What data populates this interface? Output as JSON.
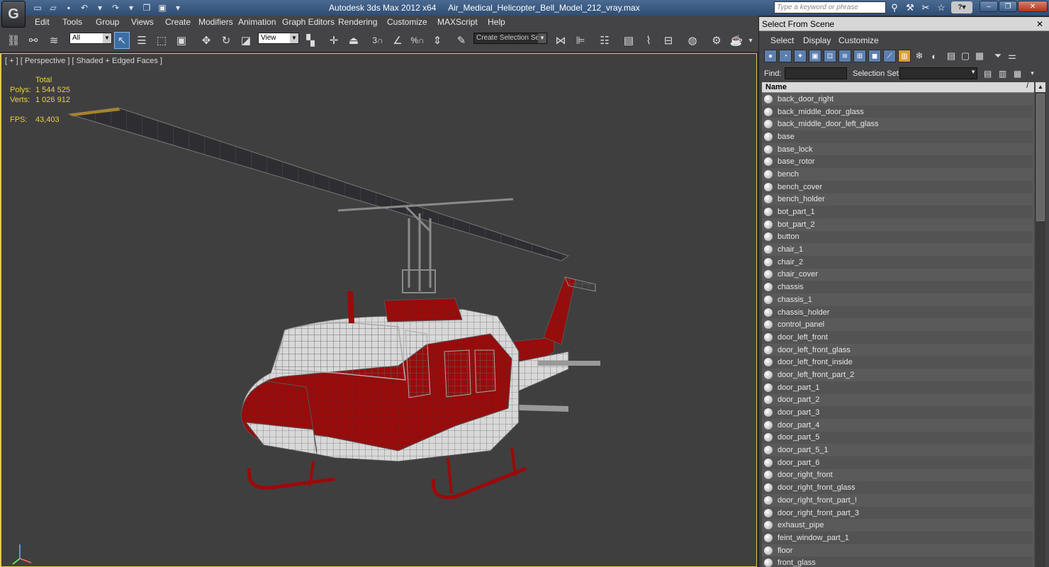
{
  "app": {
    "title": "Autodesk 3ds Max  2012 x64",
    "filename": "Air_Medical_Helicopter_Bell_Model_212_vray.max",
    "logo": "3ds-max-logo"
  },
  "search": {
    "placeholder": "Type a keyword or phrase"
  },
  "menus": [
    "Edit",
    "Tools",
    "Group",
    "Views",
    "Create",
    "Modifiers",
    "Animation",
    "Graph Editors",
    "Rendering",
    "Customize",
    "MAXScript",
    "Help"
  ],
  "toolbar": {
    "filter_value": "All",
    "ref_coord_value": "View",
    "selection_set_placeholder": "Create Selection Se"
  },
  "viewport": {
    "label": "[ + ] [ Perspective ] [ Shaded + Edged Faces ]",
    "stats": {
      "total_label": "Total",
      "polys_label": "Polys:",
      "polys_value": "1 544 525",
      "verts_label": "Verts:",
      "verts_value": "1 026 912",
      "fps_label": "FPS:",
      "fps_value": "43,403"
    },
    "model_color": "#9b0a0a"
  },
  "panel": {
    "title": "Select From Scene",
    "close_glyph": "✕",
    "menus": [
      "Select",
      "Display",
      "Customize"
    ],
    "find_label": "Find:",
    "selection_set_label": "Selection Set:",
    "column_name": "Name",
    "sort_glyph": "/",
    "objects": [
      "back_door_right",
      "back_middle_door_glass",
      "back_middle_door_left_glass",
      "base",
      "base_lock",
      "base_rotor",
      "bench",
      "bench_cover",
      "bench_holder",
      "bot_part_1",
      "bot_part_2",
      "button",
      "chair_1",
      "chair_2",
      "chair_cover",
      "chassis",
      "chassis_1",
      "chassis_holder",
      "control_panel",
      "door_left_front",
      "door_left_front_glass",
      "door_left_front_inside",
      "door_left_front_part_2",
      "door_part_1",
      "door_part_2",
      "door_part_3",
      "door_part_4",
      "door_part_5",
      "door_part_5_1",
      "door_part_6",
      "door_right_front",
      "door_right_front_glass",
      "door_right_front_part_!",
      "door_right_front_part_3",
      "exhaust_pipe",
      "feint_window_part_1",
      "floor",
      "front_glass"
    ]
  }
}
